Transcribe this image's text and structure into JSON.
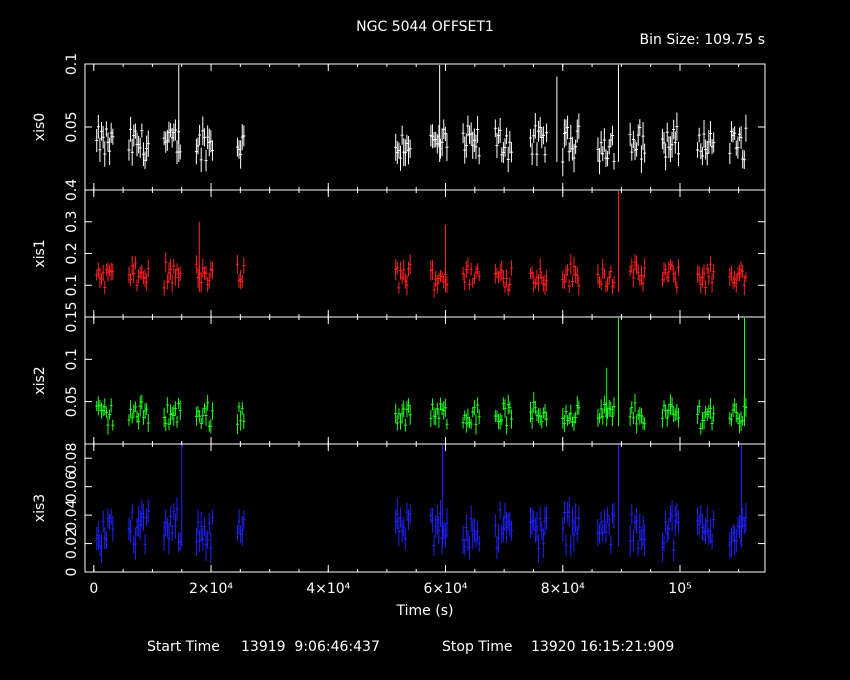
{
  "chart_data": {
    "type": "scatter",
    "title": "NGC 5044 OFFSET1",
    "bin_size_label": "Bin Size: 109.75 s",
    "xlabel": "Time (s)",
    "xlim": [
      -1500,
      114500
    ],
    "x_ticks": [
      {
        "value": 0,
        "label": "0"
      },
      {
        "value": 20000,
        "label": "2×10⁴"
      },
      {
        "value": 40000,
        "label": "4×10⁴"
      },
      {
        "value": 60000,
        "label": "6×10⁴"
      },
      {
        "value": 80000,
        "label": "8×10⁴"
      },
      {
        "value": 100000,
        "label": "10⁵"
      }
    ],
    "good_time_intervals": [
      [
        500,
        3500
      ],
      [
        6000,
        9500
      ],
      [
        12000,
        15000
      ],
      [
        17500,
        20500
      ],
      [
        24500,
        25800
      ],
      [
        51500,
        54000
      ],
      [
        57500,
        60500
      ],
      [
        63000,
        66000
      ],
      [
        68500,
        71500
      ],
      [
        74500,
        77500
      ],
      [
        80000,
        83000
      ],
      [
        86000,
        89000
      ],
      [
        91500,
        94000
      ],
      [
        97000,
        100000
      ],
      [
        103000,
        106000
      ],
      [
        108500,
        111500
      ]
    ],
    "footer": {
      "start_label": "Start Time",
      "start_value": "13919  9:06:46:437",
      "stop_label": "Stop Time",
      "stop_value": "13920 16:15:21:909"
    },
    "series": [
      {
        "name": "xis0",
        "color": "#ffffff",
        "ylim": [
          0,
          0.1
        ],
        "yticks": [
          {
            "value": 0.05,
            "label": "0.05"
          },
          {
            "value": 0.1,
            "label": "0.1"
          }
        ],
        "mean": 0.037,
        "spread": 0.012,
        "spikes": [
          [
            14500,
            0.1
          ],
          [
            59000,
            0.1
          ],
          [
            89500,
            0.1
          ],
          [
            79000,
            0.09
          ]
        ]
      },
      {
        "name": "xis1",
        "color": "#ff2020",
        "ylim": [
          0,
          0.4
        ],
        "yticks": [
          {
            "value": 0.1,
            "label": "0.1"
          },
          {
            "value": 0.2,
            "label": "0.2"
          },
          {
            "value": 0.3,
            "label": "0.3"
          },
          {
            "value": 0.4,
            "label": "0.4"
          }
        ],
        "mean": 0.13,
        "spread": 0.035,
        "spikes": [
          [
            89500,
            0.4
          ],
          [
            18000,
            0.3
          ],
          [
            60000,
            0.29
          ]
        ]
      },
      {
        "name": "xis2",
        "color": "#20ff20",
        "ylim": [
          0,
          0.15
        ],
        "yticks": [
          {
            "value": 0.05,
            "label": "0.05"
          },
          {
            "value": 0.1,
            "label": "0.1"
          },
          {
            "value": 0.15,
            "label": "0.15"
          }
        ],
        "mean": 0.035,
        "spread": 0.013,
        "spikes": [
          [
            89500,
            0.15
          ],
          [
            111000,
            0.15
          ],
          [
            87500,
            0.09
          ]
        ]
      },
      {
        "name": "xis3",
        "color": "#2020ff",
        "ylim": [
          0,
          0.09
        ],
        "yticks": [
          {
            "value": 0,
            "label": "0"
          },
          {
            "value": 0.02,
            "label": "0.02"
          },
          {
            "value": 0.04,
            "label": "0.04"
          },
          {
            "value": 0.06,
            "label": "0.06"
          },
          {
            "value": 0.08,
            "label": "0.08"
          }
        ],
        "mean": 0.03,
        "spread": 0.012,
        "spikes": [
          [
            15000,
            0.09
          ],
          [
            59500,
            0.09
          ],
          [
            89500,
            0.09
          ],
          [
            110500,
            0.09
          ]
        ]
      }
    ]
  }
}
